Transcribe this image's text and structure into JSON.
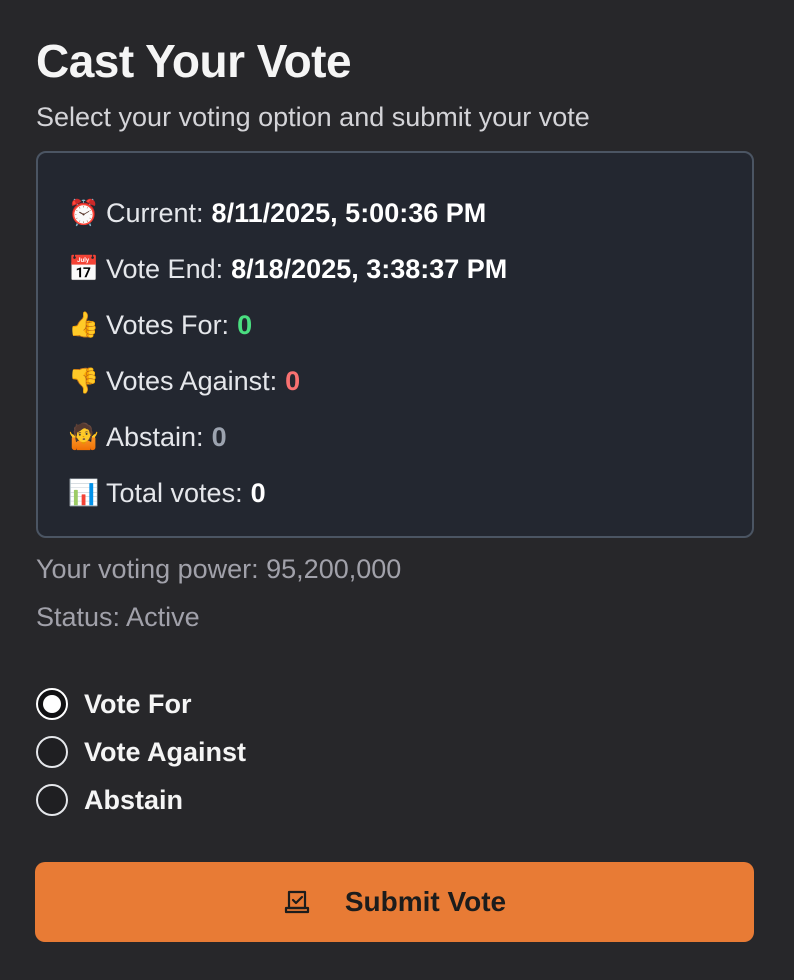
{
  "header": {
    "title": "Cast Your Vote",
    "subtitle": "Select your voting option and submit your vote"
  },
  "info": {
    "current_label": "Current:",
    "current_value": "8/11/2025, 5:00:36 PM",
    "end_label": "Vote End:",
    "end_value": "8/18/2025, 3:38:37 PM",
    "for_label": "Votes For:",
    "for_value": "0",
    "against_label": "Votes Against:",
    "against_value": "0",
    "abstain_label": "Abstain:",
    "abstain_value": "0",
    "total_label": "Total votes:",
    "total_value": "0",
    "icons": {
      "current": "⏰",
      "end": "📅",
      "for": "👍",
      "against": "👎",
      "abstain": "🤷",
      "total": "📊"
    }
  },
  "meta": {
    "voting_power": "Your voting power: 95,200,000",
    "status": "Status: Active"
  },
  "options": [
    {
      "label": "Vote For",
      "selected": true
    },
    {
      "label": "Vote Against",
      "selected": false
    },
    {
      "label": "Abstain",
      "selected": false
    }
  ],
  "submit": {
    "label": "Submit Vote",
    "icon": "ballot-box-icon",
    "color": "#e87b35"
  },
  "colors": {
    "for": "#4ade80",
    "against": "#f87171",
    "abstain": "#9ca3af"
  }
}
